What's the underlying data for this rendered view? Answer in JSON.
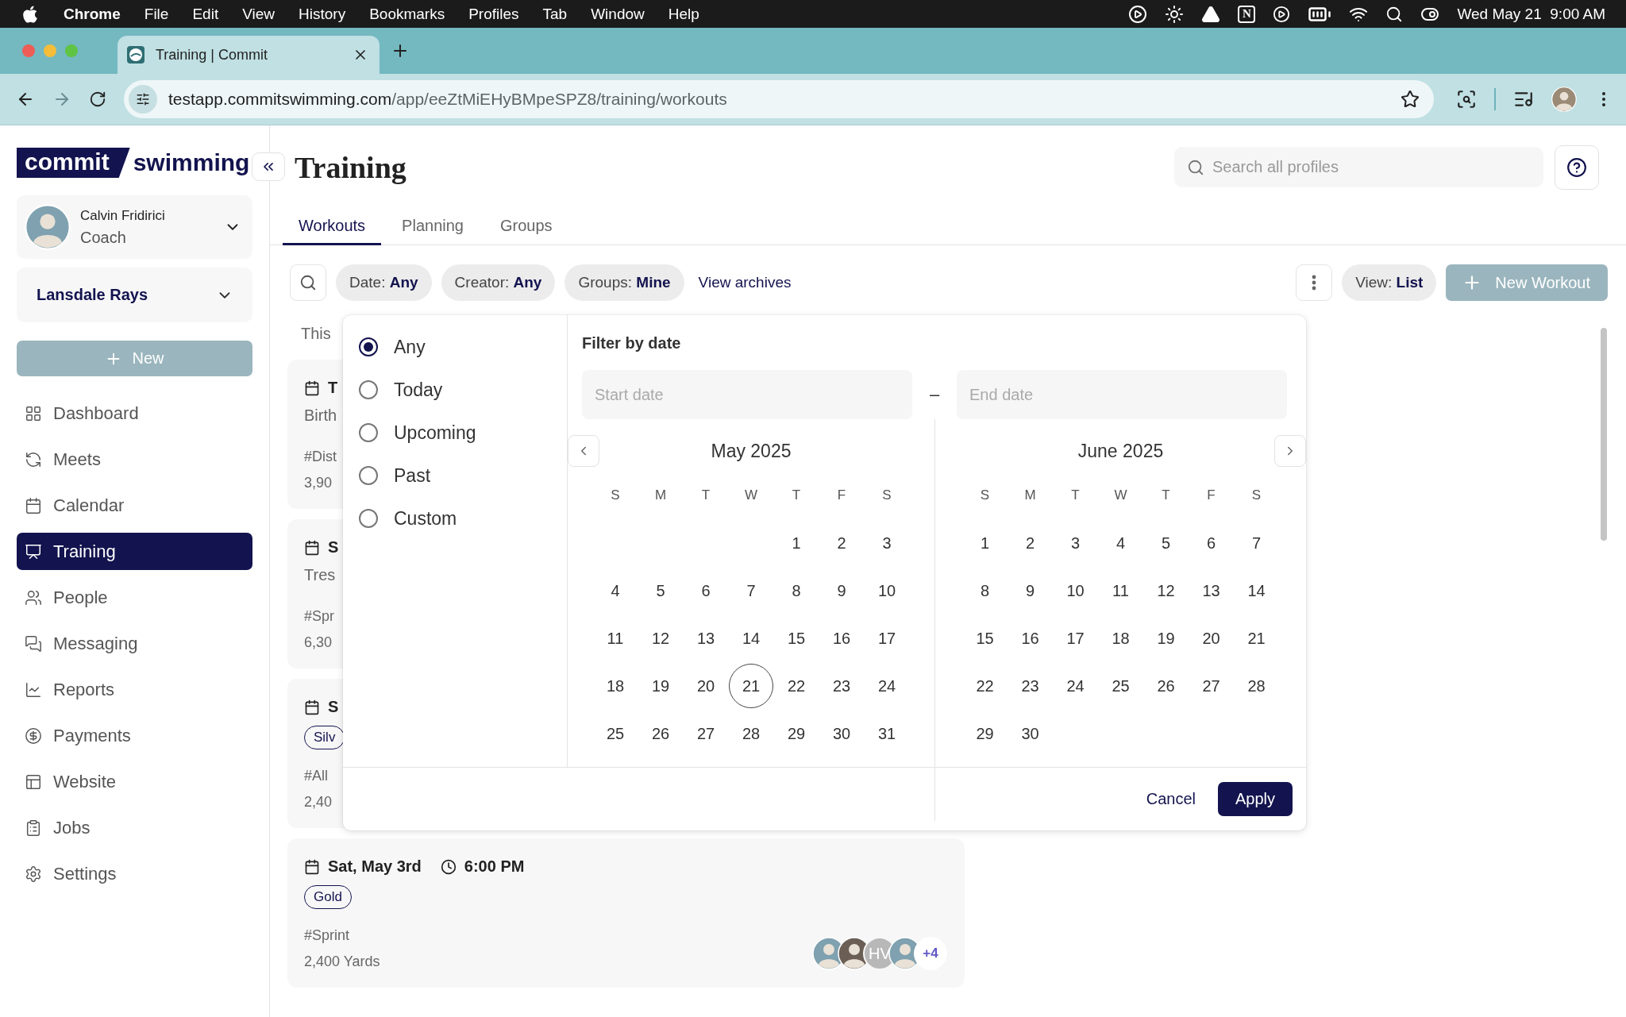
{
  "menu_bar": {
    "app": "Chrome",
    "menus": [
      "File",
      "Edit",
      "View",
      "History",
      "Bookmarks",
      "Profiles",
      "Tab",
      "Window",
      "Help"
    ],
    "status_letter": "N",
    "clock": "Wed May 21  9:00 AM"
  },
  "browser": {
    "tab_title": "Training | Commit",
    "url_host": "testapp.commitswimming.com",
    "url_path": "/app/eeZtMiEHyBMpeSPZ8/training/workouts"
  },
  "sidebar": {
    "logo": {
      "word_1": "commit",
      "word_2": "swimming"
    },
    "user": {
      "name": "Calvin Fridirici",
      "role": "Coach"
    },
    "team": "Lansdale Rays",
    "new_button": "New",
    "items": [
      {
        "label": "Dashboard",
        "kind": "grid",
        "selected": false
      },
      {
        "label": "Meets",
        "kind": "cycle",
        "selected": false
      },
      {
        "label": "Calendar",
        "kind": "calendar",
        "selected": false
      },
      {
        "label": "Training",
        "kind": "board",
        "selected": true
      },
      {
        "label": "People",
        "kind": "people",
        "selected": false
      },
      {
        "label": "Messaging",
        "kind": "chat",
        "selected": false
      },
      {
        "label": "Reports",
        "kind": "chart",
        "selected": false
      },
      {
        "label": "Payments",
        "kind": "money",
        "selected": false
      },
      {
        "label": "Website",
        "kind": "layout",
        "selected": false
      },
      {
        "label": "Jobs",
        "kind": "list",
        "selected": false
      },
      {
        "label": "Settings",
        "kind": "gear",
        "selected": false
      }
    ]
  },
  "page": {
    "title": "Training",
    "search_placeholder": "Search all profiles",
    "tabs": [
      {
        "label": "Workouts",
        "selected": true
      },
      {
        "label": "Planning",
        "selected": false
      },
      {
        "label": "Groups",
        "selected": false
      }
    ]
  },
  "filters": {
    "chips": [
      {
        "label": "Date:",
        "value": "Any"
      },
      {
        "label": "Creator:",
        "value": "Any"
      },
      {
        "label": "Groups:",
        "value": "Mine"
      }
    ],
    "archives_link": "View archives",
    "view": {
      "label": "View:",
      "value": "List"
    },
    "new_workout": "New Workout"
  },
  "list": {
    "section": "This",
    "cards": [
      {
        "date": "T",
        "subtitle": "Birth",
        "tag": "#Dist",
        "distance": "3,90"
      },
      {
        "date": "S",
        "subtitle": "Tres",
        "tag": "#Spr",
        "distance": "6,30"
      },
      {
        "date": "S",
        "badge": "Silv",
        "tag": "#All",
        "distance": "2,40"
      },
      {
        "date": "Sat, May 3rd",
        "time": "6:00 PM",
        "badge": "Gold",
        "tag": "#Sprint",
        "distance": "2,400 Yards",
        "avatars": [
          {
            "kind": "photo"
          },
          {
            "kind": "photo"
          },
          {
            "kind": "initials",
            "text": "HV"
          },
          {
            "kind": "photo"
          }
        ],
        "more": "+4"
      }
    ]
  },
  "date_filter": {
    "options": [
      {
        "label": "Any",
        "selected": true
      },
      {
        "label": "Today",
        "selected": false
      },
      {
        "label": "Upcoming",
        "selected": false
      },
      {
        "label": "Past",
        "selected": false
      },
      {
        "label": "Custom",
        "selected": false
      }
    ],
    "title": "Filter by date",
    "start_placeholder": "Start date",
    "dash": "–",
    "end_placeholder": "End date",
    "months": [
      {
        "title": "May 2025",
        "weekdays": [
          "S",
          "M",
          "T",
          "W",
          "T",
          "F",
          "S"
        ],
        "weeks": [
          {
            "kind": "tail",
            "days": [
              {
                "d": "1",
                "today": false
              },
              {
                "d": "2",
                "today": false
              },
              {
                "d": "3",
                "today": false
              }
            ]
          },
          {
            "kind": "full",
            "days": [
              {
                "d": "4",
                "today": false
              },
              {
                "d": "5",
                "today": false
              },
              {
                "d": "6",
                "today": false
              },
              {
                "d": "7",
                "today": false
              },
              {
                "d": "8",
                "today": false
              },
              {
                "d": "9",
                "today": false
              },
              {
                "d": "10",
                "today": false
              }
            ]
          },
          {
            "kind": "full",
            "days": [
              {
                "d": "11",
                "today": false
              },
              {
                "d": "12",
                "today": false
              },
              {
                "d": "13",
                "today": false
              },
              {
                "d": "14",
                "today": false
              },
              {
                "d": "15",
                "today": false
              },
              {
                "d": "16",
                "today": false
              },
              {
                "d": "17",
                "today": false
              }
            ]
          },
          {
            "kind": "full",
            "days": [
              {
                "d": "18",
                "today": false
              },
              {
                "d": "19",
                "today": false
              },
              {
                "d": "20",
                "today": false
              },
              {
                "d": "21",
                "today": true
              },
              {
                "d": "22",
                "today": false
              },
              {
                "d": "23",
                "today": false
              },
              {
                "d": "24",
                "today": false
              }
            ]
          },
          {
            "kind": "full",
            "days": [
              {
                "d": "25",
                "today": false
              },
              {
                "d": "26",
                "today": false
              },
              {
                "d": "27",
                "today": false
              },
              {
                "d": "28",
                "today": false
              },
              {
                "d": "29",
                "today": false
              },
              {
                "d": "30",
                "today": false
              },
              {
                "d": "31",
                "today": false
              }
            ]
          }
        ]
      },
      {
        "title": "June 2025",
        "weekdays": [
          "S",
          "M",
          "T",
          "W",
          "T",
          "F",
          "S"
        ],
        "weeks": [
          {
            "kind": "full",
            "days": [
              {
                "d": "1",
                "today": false
              },
              {
                "d": "2",
                "today": false
              },
              {
                "d": "3",
                "today": false
              },
              {
                "d": "4",
                "today": false
              },
              {
                "d": "5",
                "today": false
              },
              {
                "d": "6",
                "today": false
              },
              {
                "d": "7",
                "today": false
              }
            ]
          },
          {
            "kind": "full",
            "days": [
              {
                "d": "8",
                "today": false
              },
              {
                "d": "9",
                "today": false
              },
              {
                "d": "10",
                "today": false
              },
              {
                "d": "11",
                "today": false
              },
              {
                "d": "12",
                "today": false
              },
              {
                "d": "13",
                "today": false
              },
              {
                "d": "14",
                "today": false
              }
            ]
          },
          {
            "kind": "full",
            "days": [
              {
                "d": "15",
                "today": false
              },
              {
                "d": "16",
                "today": false
              },
              {
                "d": "17",
                "today": false
              },
              {
                "d": "18",
                "today": false
              },
              {
                "d": "19",
                "today": false
              },
              {
                "d": "20",
                "today": false
              },
              {
                "d": "21",
                "today": false
              }
            ]
          },
          {
            "kind": "full",
            "days": [
              {
                "d": "22",
                "today": false
              },
              {
                "d": "23",
                "today": false
              },
              {
                "d": "24",
                "today": false
              },
              {
                "d": "25",
                "today": false
              },
              {
                "d": "26",
                "today": false
              },
              {
                "d": "27",
                "today": false
              },
              {
                "d": "28",
                "today": false
              }
            ]
          },
          {
            "kind": "head",
            "days": [
              {
                "d": "29",
                "today": false
              },
              {
                "d": "30",
                "today": false
              }
            ]
          }
        ]
      }
    ],
    "cancel": "Cancel",
    "apply": "Apply"
  }
}
